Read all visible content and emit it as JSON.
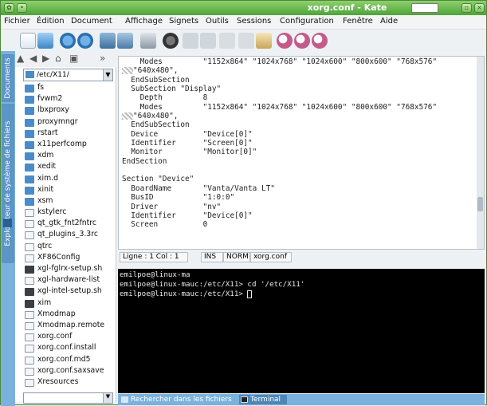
{
  "window": {
    "title": "xorg.conf - Kate"
  },
  "menubar": [
    {
      "label": "Fichier"
    },
    {
      "label": "Édition"
    },
    {
      "label": "Document"
    },
    {
      "label": "Affichage"
    },
    {
      "label": "Signets"
    },
    {
      "label": "Outils"
    },
    {
      "label": "Sessions"
    },
    {
      "label": "Configuration"
    },
    {
      "label": "Fenêtre"
    },
    {
      "label": "Aide"
    }
  ],
  "left_tabs": {
    "documents": "Documents",
    "file_browser": "Explorateur de système de fichiers"
  },
  "file_browser": {
    "path": "/etc/X11/",
    "files": [
      {
        "name": "fs",
        "type": "folder"
      },
      {
        "name": "fvwm2",
        "type": "folder"
      },
      {
        "name": "lbxproxy",
        "type": "folder"
      },
      {
        "name": "proxymngr",
        "type": "folder"
      },
      {
        "name": "rstart",
        "type": "folder"
      },
      {
        "name": "x11perfcomp",
        "type": "folder"
      },
      {
        "name": "xdm",
        "type": "folder"
      },
      {
        "name": "xedit",
        "type": "folder"
      },
      {
        "name": "xim.d",
        "type": "folder"
      },
      {
        "name": "xinit",
        "type": "folder"
      },
      {
        "name": "xsm",
        "type": "folder"
      },
      {
        "name": "kstylerc",
        "type": "file"
      },
      {
        "name": "qt_gtk_fnt2fntrc",
        "type": "file"
      },
      {
        "name": "qt_plugins_3.3rc",
        "type": "file"
      },
      {
        "name": "qtrc",
        "type": "file"
      },
      {
        "name": "XF86Config",
        "type": "file"
      },
      {
        "name": "xgl-fglrx-setup.sh",
        "type": "script"
      },
      {
        "name": "xgl-hardware-list",
        "type": "file"
      },
      {
        "name": "xgl-intel-setup.sh",
        "type": "script"
      },
      {
        "name": "xim",
        "type": "script"
      },
      {
        "name": "Xmodmap",
        "type": "file"
      },
      {
        "name": "Xmodmap.remote",
        "type": "file"
      },
      {
        "name": "xorg.conf",
        "type": "file"
      },
      {
        "name": "xorg.conf.install",
        "type": "file"
      },
      {
        "name": "xorg.conf.md5",
        "type": "file"
      },
      {
        "name": "xorg.conf.saxsave",
        "type": "file"
      },
      {
        "name": "Xresources",
        "type": "file"
      }
    ]
  },
  "editor": {
    "lines": [
      "    Modes         \"1152x864\" \"1024x768\" \"1024x600\" \"800x600\" \"768x576\"",
      "@@\"640x480\",",
      "  EndSubSection",
      "  SubSection \"Display\"",
      "    Depth         8",
      "    Modes         \"1152x864\" \"1024x768\" \"1024x600\" \"800x600\" \"768x576\"",
      "@@\"640x480\",",
      "  EndSubSection",
      "  Device          \"Device[0]\"",
      "  Identifier      \"Screen[0]\"",
      "  Monitor         \"Monitor[0]\"",
      "EndSection",
      "",
      "Section \"Device\"",
      "  BoardName       \"Vanta/Vanta LT\"",
      "  BusID           \"1:0:0\"",
      "  Driver          \"nv\"",
      "  Identifier      \"Device[0]\"",
      "  Screen          0"
    ]
  },
  "statusbar": {
    "position": "Ligne : 1 Col : 1",
    "ins": "INS",
    "norm": "NORM",
    "filename": "xorg.conf"
  },
  "terminal": {
    "lines": [
      "emilpoe@linux-ma",
      "emilpoe@linux-mauc:/etc/X11> cd '/etc/X11'",
      "emilpoe@linux-mauc:/etc/X11> "
    ]
  },
  "bottom_tabs": [
    {
      "label": "Rechercher dans les fichiers"
    },
    {
      "label": "Terminal"
    }
  ],
  "colors": {
    "accent": "#4ea33a",
    "panel_blue": "#7bb2dd",
    "terminal_bg": "#000000"
  }
}
